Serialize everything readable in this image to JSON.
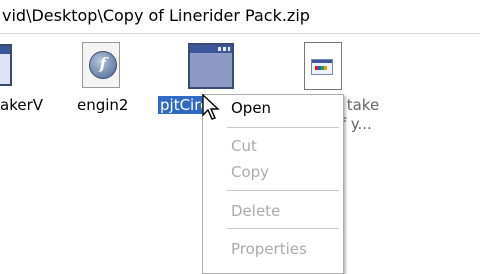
{
  "address": {
    "path": "vid\\Desktop\\Copy of Linerider Pack.zip"
  },
  "files": [
    {
      "label": "akerV",
      "icon": "window-icon"
    },
    {
      "label": "engin2",
      "icon": "app-icon"
    },
    {
      "label": "pjtCirc Maker",
      "icon": "window-icon",
      "selected": true
    },
    {
      "label": "",
      "icon": "document-icon"
    }
  ],
  "file_description": {
    "line1": "this is to take",
    "line2": "videos of y..."
  },
  "context_menu": {
    "open": "Open",
    "cut": "Cut",
    "copy": "Copy",
    "delete": "Delete",
    "properties": "Properties"
  },
  "colors": {
    "selection": "#316ac5",
    "disabled_text": "#ababab"
  }
}
